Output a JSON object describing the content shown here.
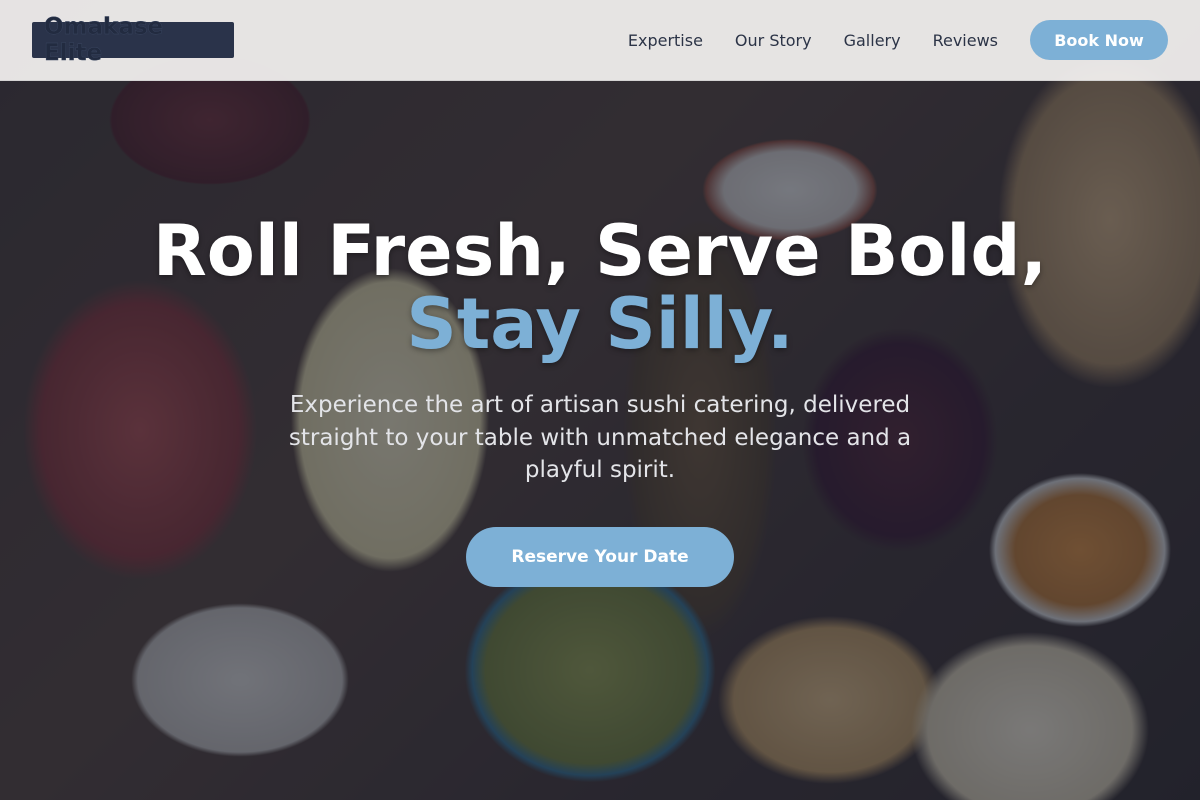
{
  "nav": {
    "brand": "Omakase Elite",
    "links": [
      {
        "label": "Expertise"
      },
      {
        "label": "Our Story"
      },
      {
        "label": "Gallery"
      },
      {
        "label": "Reviews"
      }
    ],
    "cta_label": "Book Now"
  },
  "hero": {
    "headline_line1": "Roll Fresh, Serve Bold,",
    "headline_accent": "Stay Silly.",
    "subtext": "Experience the art of artisan sushi catering, delivered straight to your table with unmatched elegance and a playful spirit.",
    "cta_label": "Reserve Your Date",
    "background_image": "charcuterie-board-photo"
  },
  "colors": {
    "accent": "#7db0d6",
    "navbar_bg": "#f4f2f1",
    "logo_bg": "#262f45",
    "nav_text": "#2c3447",
    "overlay": "#1c2130"
  }
}
